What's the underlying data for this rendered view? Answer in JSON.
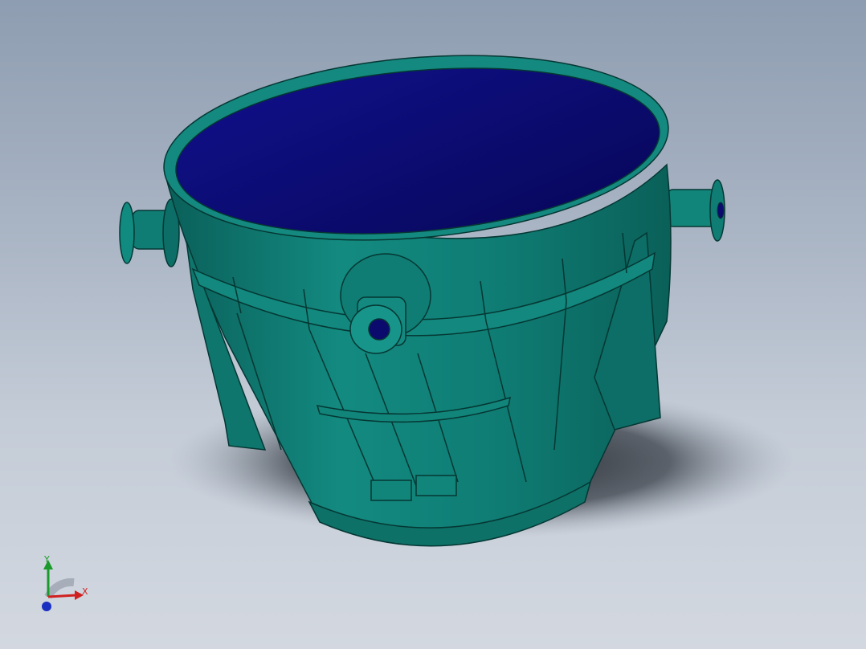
{
  "viewport": {
    "background_top": "#8e9db1",
    "background_bottom": "#d3d8e0"
  },
  "model": {
    "name": "ladle",
    "body_color": "#0e7a72",
    "body_highlight": "#2aa69a",
    "body_shadow": "#064d48",
    "interior_color": "#0b0b6e",
    "edge_color": "#053733"
  },
  "triad": {
    "y_label": "Y",
    "x_label": "X",
    "y_color": "#1a9a2a",
    "x_color": "#d02020",
    "z_color": "#1a30c0"
  }
}
